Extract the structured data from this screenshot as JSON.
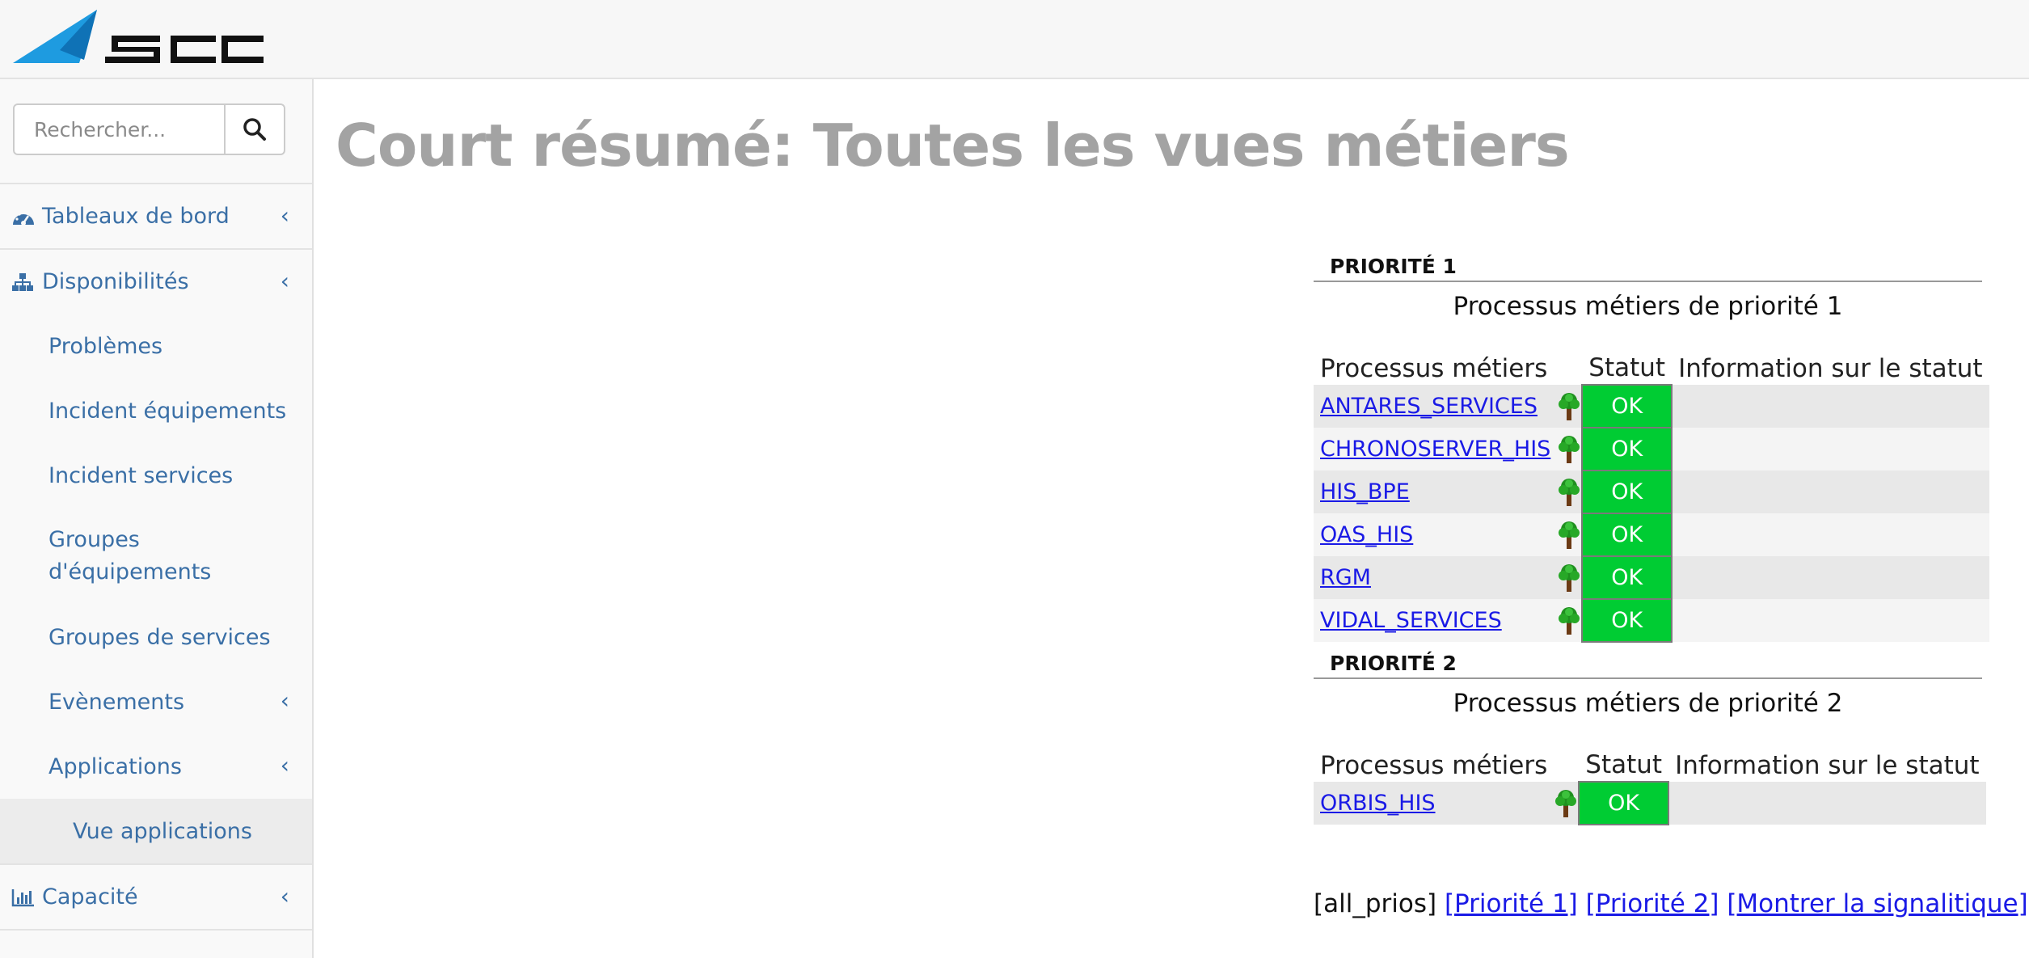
{
  "header": {
    "logo_text": "SCC"
  },
  "sidebar": {
    "search": {
      "placeholder": "Rechercher..."
    },
    "items": [
      {
        "label": "Tableaux de bord"
      },
      {
        "label": "Disponibilités"
      },
      {
        "label": "Problèmes"
      },
      {
        "label": "Incident équipements"
      },
      {
        "label": "Incident services"
      },
      {
        "label": "Groupes d'équipements"
      },
      {
        "label": "Groupes de services"
      },
      {
        "label": "Evènements"
      },
      {
        "label": "Applications"
      },
      {
        "label": "Vue applications"
      },
      {
        "label": "Capacité"
      }
    ]
  },
  "main": {
    "title": "Court résumé: Toutes les vues métiers",
    "columns": {
      "process": "Processus métiers",
      "status": "Statut",
      "info": "Information sur le statut"
    },
    "priorities": [
      {
        "heading": "PRIORITÉ 1",
        "caption": "Processus métiers de priorité 1",
        "rows": [
          {
            "name": "ANTARES_SERVICES",
            "status": "OK",
            "info": ""
          },
          {
            "name": "CHRONOSERVER_HIS",
            "status": "OK",
            "info": ""
          },
          {
            "name": "HIS_BPE",
            "status": "OK",
            "info": ""
          },
          {
            "name": "OAS_HIS",
            "status": "OK",
            "info": ""
          },
          {
            "name": "RGM",
            "status": "OK",
            "info": ""
          },
          {
            "name": "VIDAL_SERVICES",
            "status": "OK",
            "info": ""
          }
        ]
      },
      {
        "heading": "PRIORITÉ 2",
        "caption": "Processus métiers de priorité 2",
        "rows": [
          {
            "name": "ORBIS_HIS",
            "status": "OK",
            "info": ""
          }
        ]
      }
    ],
    "footer": {
      "current": "[all_prios]",
      "links": [
        "[Priorité 1]",
        "[Priorité 2]",
        "[Montrer la signalitique]"
      ]
    }
  },
  "colors": {
    "link": "#1a1ae6",
    "nav_text": "#3a6fa6",
    "status_ok": "#00cc33",
    "logo_blue": "#1e9be0"
  },
  "icons": {
    "search": "search-icon",
    "dashboard": "dashboard-icon",
    "sitemap": "sitemap-icon",
    "chart": "bar-chart-icon",
    "tree": "tree-icon",
    "chevron": "chevron-left-icon"
  }
}
